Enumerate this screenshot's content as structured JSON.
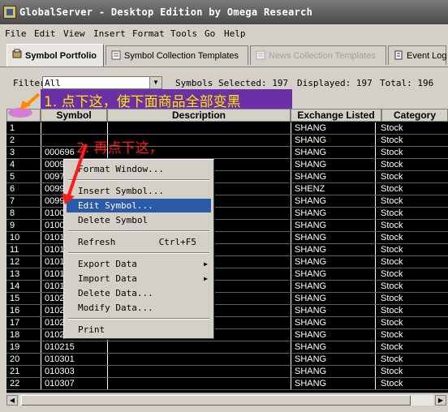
{
  "window": {
    "title": "GlobalServer - Desktop Edition by Omega Research"
  },
  "menu": [
    "File",
    "Edit",
    "View",
    "Insert",
    "Format",
    "Tools",
    "Go",
    "Help"
  ],
  "tabs": [
    {
      "label": "Symbol Portfolio",
      "active": true
    },
    {
      "label": "Symbol Collection Templates",
      "active": false
    },
    {
      "label": "News Collection Templates",
      "disabled": true
    },
    {
      "label": "Event Log",
      "active": false
    }
  ],
  "filter": {
    "label": "Filter",
    "value": "All"
  },
  "stats": {
    "selected": "Symbols Selected: 197",
    "displayed": "Displayed: 197",
    "total": "Total: 196"
  },
  "annotations": {
    "step1": "1. 点下这，使下面商品全部变黑",
    "step2": "2. 再点下这，"
  },
  "grid": {
    "headers": {
      "symbol": "Symbol",
      "description": "Description",
      "exchange": "Exchange Listed",
      "category": "Category"
    },
    "rows": [
      {
        "n": "1",
        "sym": "",
        "exch": "SHANG",
        "cat": "Stock"
      },
      {
        "n": "2",
        "sym": "",
        "exch": "SHANG",
        "cat": "Stock"
      },
      {
        "n": "3",
        "sym": "000696",
        "exch": "SHANG",
        "cat": "Stock"
      },
      {
        "n": "4",
        "sym": "0009",
        "exch": "SHANG",
        "cat": "Stock"
      },
      {
        "n": "5",
        "sym": "0097",
        "exch": "SHANG",
        "cat": "Stock"
      },
      {
        "n": "6",
        "sym": "0099",
        "exch": "SHENZ",
        "cat": "Stock"
      },
      {
        "n": "7",
        "sym": "0099",
        "exch": "SHANG",
        "cat": "Stock"
      },
      {
        "n": "8",
        "sym": "0100",
        "exch": "SHANG",
        "cat": "Stock"
      },
      {
        "n": "9",
        "sym": "0100",
        "exch": "SHANG",
        "cat": "Stock"
      },
      {
        "n": "10",
        "sym": "0101",
        "exch": "SHANG",
        "cat": "Stock"
      },
      {
        "n": "11",
        "sym": "0101",
        "exch": "SHANG",
        "cat": "Stock"
      },
      {
        "n": "12",
        "sym": "0101",
        "exch": "SHANG",
        "cat": "Stock"
      },
      {
        "n": "13",
        "sym": "0101",
        "exch": "SHANG",
        "cat": "Stock"
      },
      {
        "n": "14",
        "sym": "0101",
        "exch": "SHANG",
        "cat": "Stock"
      },
      {
        "n": "15",
        "sym": "0102",
        "exch": "SHANG",
        "cat": "Stock"
      },
      {
        "n": "16",
        "sym": "0102",
        "exch": "SHANG",
        "cat": "Stock"
      },
      {
        "n": "17",
        "sym": "0102",
        "exch": "SHANG",
        "cat": "Stock"
      },
      {
        "n": "18",
        "sym": "0102",
        "exch": "SHANG",
        "cat": "Stock"
      },
      {
        "n": "19",
        "sym": "010215",
        "exch": "SHANG",
        "cat": "Stock"
      },
      {
        "n": "20",
        "sym": "010301",
        "exch": "SHANG",
        "cat": "Stock"
      },
      {
        "n": "21",
        "sym": "010303",
        "exch": "SHANG",
        "cat": "Stock"
      },
      {
        "n": "22",
        "sym": "010307",
        "exch": "SHANG",
        "cat": "Stock"
      }
    ]
  },
  "context_menu": [
    {
      "label": "Format Window..."
    },
    {
      "sep": true
    },
    {
      "label": "Insert Symbol..."
    },
    {
      "label": "Edit Symbol...",
      "highlight": true
    },
    {
      "label": "Delete Symbol"
    },
    {
      "sep": true
    },
    {
      "label": "Refresh",
      "shortcut": "Ctrl+F5"
    },
    {
      "sep": true
    },
    {
      "label": "Export Data",
      "submenu": true
    },
    {
      "label": "Import Data",
      "submenu": true
    },
    {
      "label": "Delete Data..."
    },
    {
      "label": "Modify Data..."
    },
    {
      "sep": true
    },
    {
      "label": "Print"
    }
  ],
  "colors": {
    "annotation_bar": "#6b2fa8",
    "annotation_text1": "#ffe800",
    "annotation_text2": "#ff1a1a",
    "highlight": "#2a5aa8"
  }
}
